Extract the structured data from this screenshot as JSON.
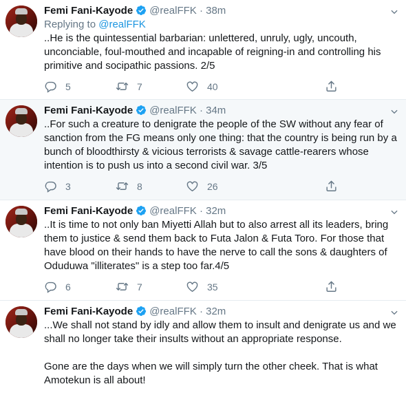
{
  "tweets": [
    {
      "name": "Femi Fani-Kayode",
      "handle": "@realFFK",
      "dot": "·",
      "time": "38m",
      "reply_prefix": "Replying to",
      "reply_handle": "@realFFK",
      "text": "..He is the quintessential barbarian: unlettered, unruly, ugly, uncouth, unconciable, foul-mouthed and incapable of reigning-in and controlling his primitive and socipathic passions. 2/5",
      "replies": "5",
      "retweets": "7",
      "likes": "40"
    },
    {
      "name": "Femi Fani-Kayode",
      "handle": "@realFFK",
      "dot": "·",
      "time": "34m",
      "text": "..For such a creature to denigrate the people of the SW without any fear of sanction from the FG means only one thing: that the country is being run by a bunch of bloodthirsty & vicious terrorists & savage cattle-rearers whose intention is to push us into a second civil war. 3/5",
      "replies": "3",
      "retweets": "8",
      "likes": "26"
    },
    {
      "name": "Femi Fani-Kayode",
      "handle": "@realFFK",
      "dot": "·",
      "time": "32m",
      "text": "..It is time to not only ban Miyetti Allah but to also arrest all its leaders, bring them to justice & send them back to Futa Jalon & Futa Toro. For those that have blood on their hands to have the nerve to call the sons & daughters of Oduduwa \"illiterates\" is a step too far.4/5",
      "replies": "6",
      "retweets": "7",
      "likes": "35"
    },
    {
      "name": "Femi Fani-Kayode",
      "handle": "@realFFK",
      "dot": "·",
      "time": "32m",
      "text": "...We shall not stand by idly and allow them to insult and denigrate us and we shall no longer take their insults without an appropriate response.",
      "text2": "Gone are the days when we will simply turn the other cheek. That is what Amotekun is all about!"
    }
  ],
  "icons": {
    "verified": "verified-badge-icon",
    "reply": "reply-icon",
    "retweet": "retweet-icon",
    "like": "like-icon",
    "share": "share-icon",
    "more": "chevron-down-icon"
  },
  "colors": {
    "verified": "#1da1f2",
    "link": "#1b95e0",
    "muted": "#657786",
    "highlight_bg": "#f5f8fa"
  }
}
